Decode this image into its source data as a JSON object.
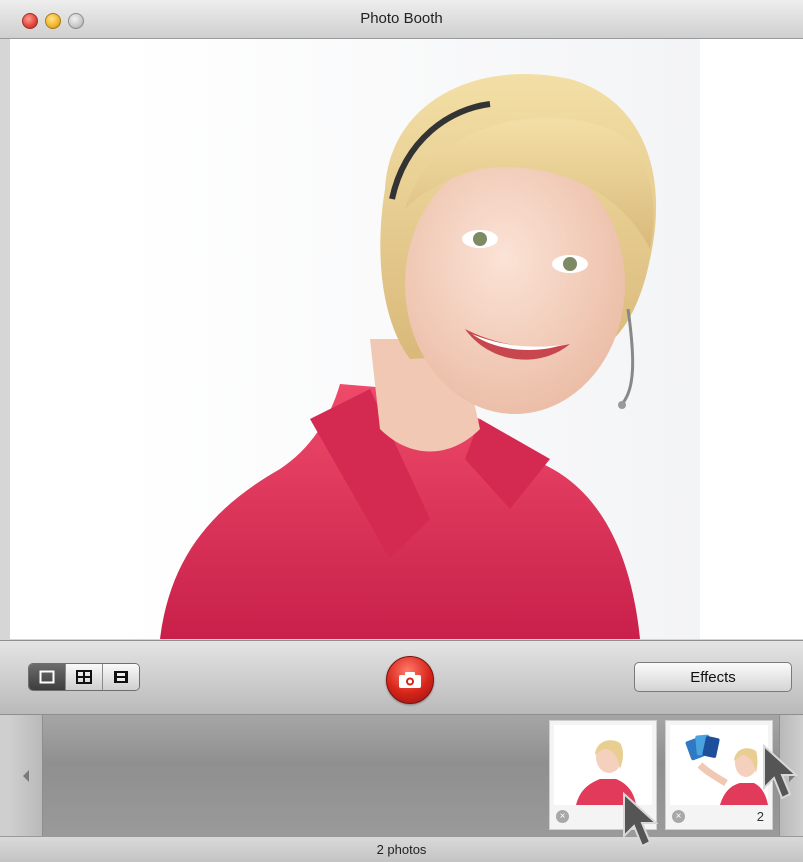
{
  "window": {
    "title": "Photo Booth"
  },
  "toolbar": {
    "view_modes": [
      {
        "name": "single-photo-mode",
        "icon": "single-frame-icon",
        "selected": true
      },
      {
        "name": "four-up-mode",
        "icon": "four-grid-icon",
        "selected": false
      },
      {
        "name": "movie-clip-mode",
        "icon": "film-strip-icon",
        "selected": false
      }
    ],
    "shutter_icon": "camera-icon",
    "effects_label": "Effects"
  },
  "tray": {
    "thumbnails": [
      {
        "index_label": "",
        "description": "woman in pink shirt with headset"
      },
      {
        "index_label": "2",
        "description": "woman holding credit cards"
      }
    ]
  },
  "status": {
    "count_label": "2 photos"
  },
  "colors": {
    "shutter_red": "#d7241a",
    "shirt_pink": "#e23a5a"
  }
}
